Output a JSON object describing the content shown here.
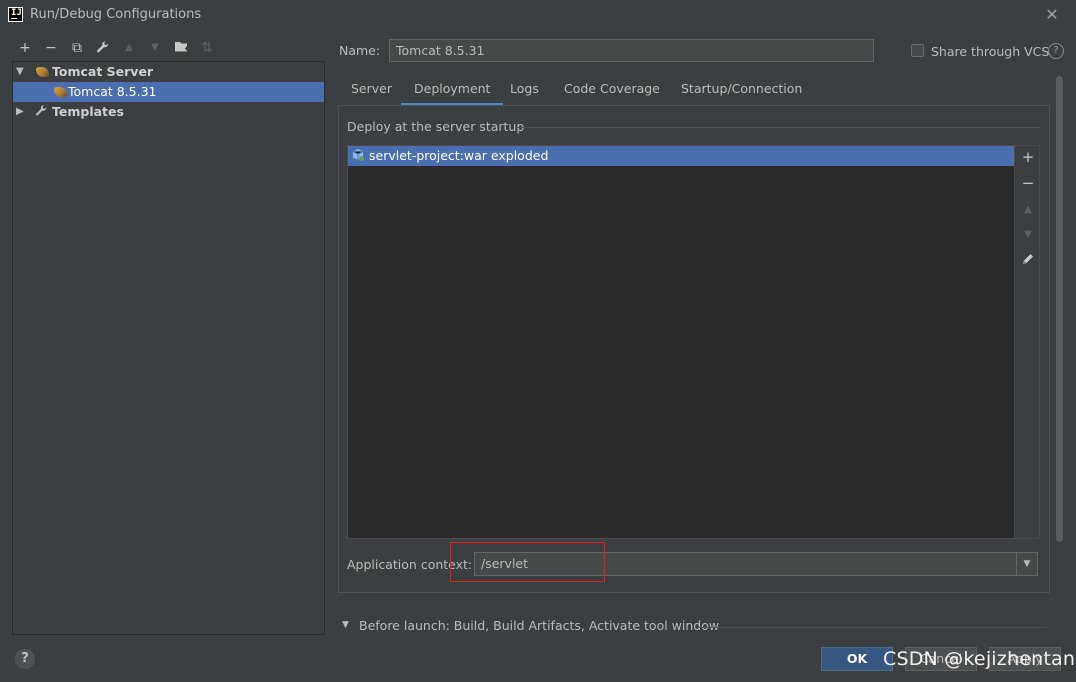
{
  "window": {
    "title": "Run/Debug Configurations",
    "app_icon_text": "IJ"
  },
  "toolbar": {
    "icons": [
      "add-icon",
      "remove-icon",
      "copy-icon",
      "wrench-icon",
      "move-up-icon",
      "move-down-icon",
      "new-folder-icon",
      "sort-icon"
    ]
  },
  "tree": {
    "group": "Tomcat Server",
    "config": "Tomcat 8.5.31",
    "templates": "Templates"
  },
  "config": {
    "name_label": "Name:",
    "name_value": "Tomcat 8.5.31",
    "share_label": "Share through VCS",
    "share_checked": false
  },
  "tabs": [
    {
      "label": "Server"
    },
    {
      "label": "Deployment",
      "active": true
    },
    {
      "label": "Logs"
    },
    {
      "label": "Code Coverage"
    },
    {
      "label": "Startup/Connection"
    }
  ],
  "deployment": {
    "group_title": "Deploy at the server startup",
    "items": [
      "servlet-project:war exploded"
    ],
    "context_label": "Application context:",
    "context_value": "/servlet"
  },
  "before_launch": {
    "text": "Before launch: Build, Build Artifacts, Activate tool window"
  },
  "buttons": {
    "ok": "OK",
    "cancel": "Cancel",
    "apply": "Apply"
  },
  "watermark": "CSDN @kejizhentan",
  "colors": {
    "selection": "#4b6eaf",
    "tab_underline": "#4a88c7",
    "ok_button": "#365880",
    "highlight_box": "#e02020",
    "background": "#3c3f41"
  }
}
